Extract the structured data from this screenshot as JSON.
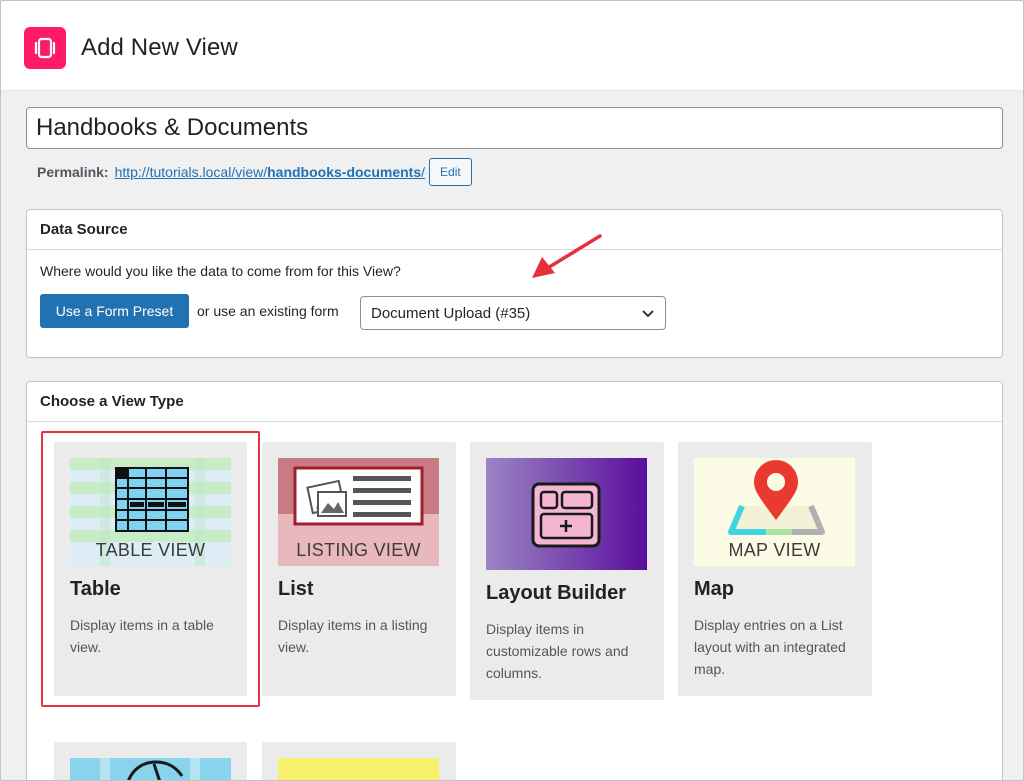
{
  "header": {
    "title": "Add New View"
  },
  "view_title": {
    "value": "Handbooks & Documents"
  },
  "permalink": {
    "label": "Permalink:",
    "url_base": "http://tutorials.local/view/",
    "slug": "handbooks-documents",
    "url_end": "/",
    "edit_label": "Edit"
  },
  "data_source": {
    "heading": "Data Source",
    "question": "Where would you like the data to come from for this View?",
    "preset_button": "Use a Form Preset",
    "or_text": "or use an existing form",
    "selected_form": "Document Upload (#35)"
  },
  "view_type": {
    "heading": "Choose a View Type",
    "cards": [
      {
        "title": "Table",
        "thumb_label": "TABLE VIEW",
        "description": "Display items in a table view."
      },
      {
        "title": "List",
        "thumb_label": "LISTING VIEW",
        "description": "Display items in a listing view."
      },
      {
        "title": "Layout Builder",
        "thumb_label": "",
        "description": "Display items in customizable rows and columns."
      },
      {
        "title": "Map",
        "thumb_label": "MAP VIEW",
        "description": "Display entries on a List layout with an integrated map."
      }
    ]
  },
  "colors": {
    "brand": "#ff1b67",
    "primary_button": "#2271b1",
    "selection_outline": "#e4343f",
    "annotation_arrow": "#e8303c"
  }
}
